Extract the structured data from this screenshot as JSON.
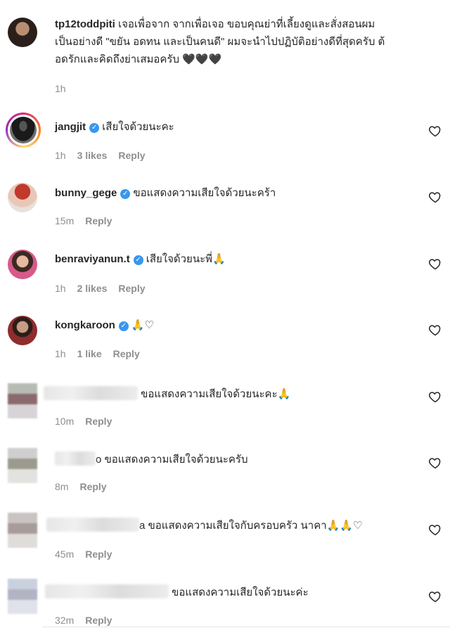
{
  "comments": [
    {
      "user": "tp12toddpiti",
      "verified": false,
      "lines": [
        "เจอเพื่อจาก จากเพื่อเจอ ขอบคุณย่าที่เลี้ยงดูและสั่งสอนผม",
        "เป็นอย่างดี \"ขยัน อดทน และเป็นคนดี\" ผมจะนำไปปฏิบัติอย่างดีที่สุดครับ ต้",
        "อดรักและคิดถึงย่าเสมอครับ 🖤🖤🖤"
      ],
      "time": "1h",
      "likes": "",
      "reply": ""
    },
    {
      "user": "jangjit",
      "verified": true,
      "text": "เสียใจด้วยนะคะ",
      "time": "1h",
      "likes": "3 likes",
      "reply": "Reply"
    },
    {
      "user": "bunny_gege",
      "verified": true,
      "text": "ขอแสดงความเสียใจด้วยนะคร้า",
      "time": "15m",
      "likes": "",
      "reply": "Reply"
    },
    {
      "user": "benraviyanun.t",
      "verified": true,
      "text": "เสียใจด้วยนะพี่🙏",
      "time": "1h",
      "likes": "2 likes",
      "reply": "Reply"
    },
    {
      "user": "kongkaroon",
      "verified": true,
      "text": "🙏♡",
      "time": "1h",
      "likes": "1 like",
      "reply": "Reply"
    },
    {
      "user": "",
      "verified": false,
      "text": "ขอแสดงความเสียใจด้วยนะคะ🙏",
      "time": "10m",
      "likes": "",
      "reply": "Reply"
    },
    {
      "user": "o",
      "verified": false,
      "text": "ขอแสดงความเสียใจด้วยนะครับ",
      "time": "8m",
      "likes": "",
      "reply": "Reply"
    },
    {
      "user": "a",
      "verified": false,
      "text": "ขอแสดงความเสียใจกับครอบครัว นาคา🙏🙏♡",
      "time": "45m",
      "likes": "",
      "reply": "Reply"
    },
    {
      "user": "",
      "verified": false,
      "text": "ขอแสดงความเสียใจด้วยนะค่ะ",
      "time": "32m",
      "likes": "",
      "reply": "Reply"
    }
  ],
  "icons": {
    "like": "heart-outline-icon",
    "verified": "verified-badge-icon"
  },
  "colors": {
    "verified": "#3897f0",
    "meta": "#8e8e8e",
    "text": "#262626"
  }
}
